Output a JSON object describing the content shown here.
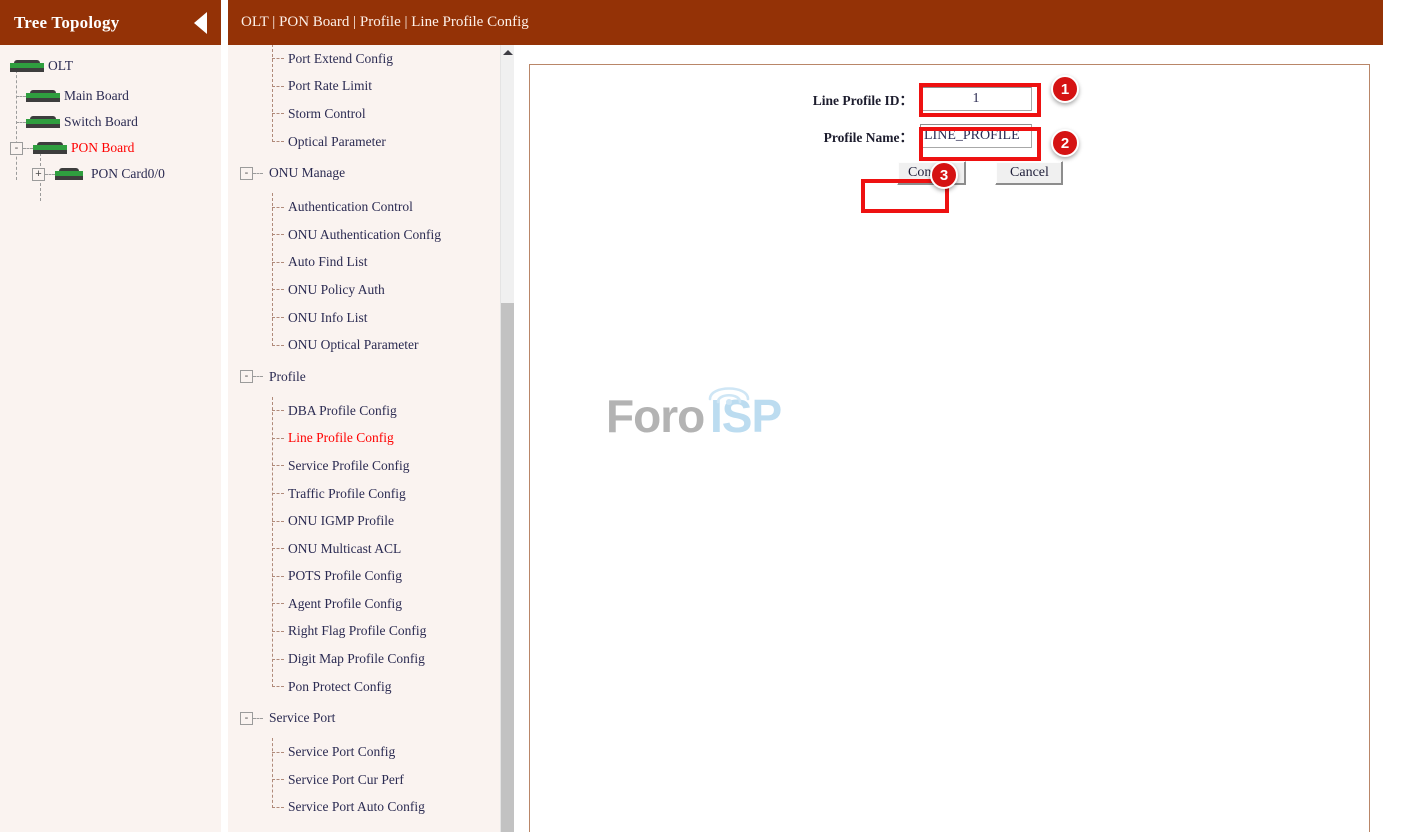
{
  "tree": {
    "header_title": "Tree Topology",
    "collapse_icon": "triangle-left-icon",
    "nodes": [
      {
        "label": "OLT",
        "icon": "device-icon",
        "expander": "",
        "depth": 0,
        "active": false
      },
      {
        "label": "Main Board",
        "icon": "device-icon",
        "expander": "",
        "depth": 1,
        "active": false
      },
      {
        "label": "Switch Board",
        "icon": "device-icon",
        "expander": "",
        "depth": 1,
        "active": false
      },
      {
        "label": "PON Board",
        "icon": "device-icon",
        "expander": "-",
        "depth": 1,
        "active": true
      },
      {
        "label": "PON Card0/0",
        "icon": "device-icon",
        "expander": "+",
        "depth": 2,
        "active": false
      }
    ]
  },
  "header": {
    "breadcrumb": "OLT | PON Board | Profile | Line Profile Config"
  },
  "nav": {
    "top_items": [
      {
        "label": "Port Extend Config",
        "selected": false
      },
      {
        "label": "Port Rate Limit",
        "selected": false
      },
      {
        "label": "Storm Control",
        "selected": false
      },
      {
        "label": "Optical Parameter",
        "selected": false
      }
    ],
    "groups": [
      {
        "label": "ONU Manage",
        "expander": "-",
        "items": [
          {
            "label": "Authentication Control",
            "selected": false
          },
          {
            "label": "ONU Authentication Config",
            "selected": false
          },
          {
            "label": "Auto Find List",
            "selected": false
          },
          {
            "label": "ONU Policy Auth",
            "selected": false
          },
          {
            "label": "ONU Info List",
            "selected": false
          },
          {
            "label": "ONU Optical Parameter",
            "selected": false
          }
        ]
      },
      {
        "label": "Profile",
        "expander": "-",
        "items": [
          {
            "label": "DBA Profile Config",
            "selected": false
          },
          {
            "label": "Line Profile Config",
            "selected": true
          },
          {
            "label": "Service Profile Config",
            "selected": false
          },
          {
            "label": "Traffic Profile Config",
            "selected": false
          },
          {
            "label": "ONU IGMP Profile",
            "selected": false
          },
          {
            "label": "ONU Multicast ACL",
            "selected": false
          },
          {
            "label": "POTS Profile Config",
            "selected": false
          },
          {
            "label": "Agent Profile Config",
            "selected": false
          },
          {
            "label": "Right Flag Profile Config",
            "selected": false
          },
          {
            "label": "Digit Map Profile Config",
            "selected": false
          },
          {
            "label": "Pon Protect Config",
            "selected": false
          }
        ]
      },
      {
        "label": "Service Port",
        "expander": "-",
        "items": [
          {
            "label": "Service Port Config",
            "selected": false
          },
          {
            "label": "Service Port Cur Perf",
            "selected": false
          },
          {
            "label": "Service Port Auto Config",
            "selected": false
          }
        ]
      }
    ],
    "scrollbar": {
      "up_icon": "caret-up-icon"
    }
  },
  "form": {
    "fields": [
      {
        "label": "Line Profile ID：",
        "value": "1",
        "placeholder": "",
        "align": "center"
      },
      {
        "label": "Profile Name：",
        "value": "LINE_PROFILE",
        "placeholder": "",
        "align": "left"
      }
    ],
    "confirm_label": "Confirm",
    "cancel_label": "Cancel"
  },
  "annotations": [
    {
      "number": "1"
    },
    {
      "number": "2"
    },
    {
      "number": "3"
    }
  ],
  "watermark": {
    "text_gray": "Foro",
    "text_blue": "ISP",
    "icon": "wifi-signal-icon"
  },
  "colors": {
    "brand_brown": "#943206",
    "panel_bg": "#faf3f0",
    "accent_red": "#ff0000",
    "annotation_red": "#d51313",
    "border_brown": "#b98668"
  }
}
